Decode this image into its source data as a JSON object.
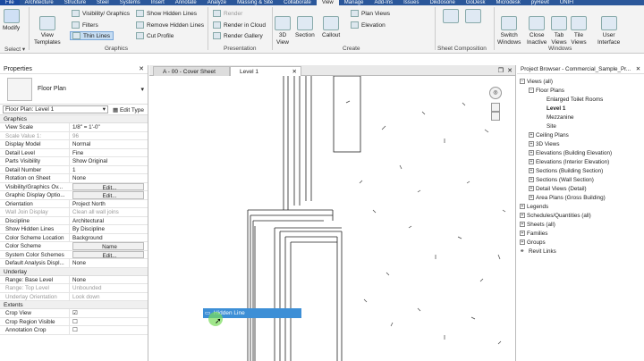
{
  "menu": [
    "File",
    "Architecture",
    "Structure",
    "Steel",
    "Systems",
    "Insert",
    "Annotate",
    "Analyze",
    "Massing & Site",
    "Collaborate",
    "View",
    "Manage",
    "Add-Ins",
    "Issues",
    "Dikdosone",
    "GoDesk",
    "Microdesk",
    "pyRevit",
    "UNIFI"
  ],
  "ribbon": {
    "modify": "Modify",
    "select": "Select ▾",
    "view_templates": "View\nTemplates",
    "visibility": "Visibility/ Graphics",
    "filters": "Filters",
    "thin_lines": "Thin  Lines",
    "show_hidden": "Show  Hidden Lines",
    "remove_hidden": "Remove  Hidden Lines",
    "cut_profile": "Cut  Profile",
    "graphics_label": "Graphics",
    "render": "Render",
    "render_cloud": "Render  in Cloud",
    "render_gallery": "Render  Gallery",
    "presentation_label": "Presentation",
    "view_3d": "3D\nView",
    "section": "Section",
    "callout": "Callout",
    "plan_views": "Plan  Views",
    "elevation": "Elevation",
    "create_label": "Create",
    "sheet_comp_label": "Sheet Composition",
    "switch_windows": "Switch\nWindows",
    "close_inactive": "Close\nInactive",
    "tab_views": "Tab\nViews",
    "tile_views": "Tile\nViews",
    "user_interface": "User\nInterface",
    "windows_label": "Windows"
  },
  "properties": {
    "title": "Properties",
    "type_name": "Floor Plan",
    "selector": "Floor Plan: Level 1",
    "edit_type": "Edit Type",
    "groups": [
      {
        "name": "Graphics",
        "rows": [
          {
            "k": "View Scale",
            "v": "1/8\" = 1'-0\""
          },
          {
            "k": "Scale Value    1:",
            "v": "96",
            "grey": true
          },
          {
            "k": "Display Model",
            "v": "Normal"
          },
          {
            "k": "Detail Level",
            "v": "Fine"
          },
          {
            "k": "Parts Visibility",
            "v": "Show Original"
          },
          {
            "k": "Detail Number",
            "v": "1"
          },
          {
            "k": "Rotation on Sheet",
            "v": "None"
          },
          {
            "k": "Visibility/Graphics Ov...",
            "v": "Edit...",
            "btn": true
          },
          {
            "k": "Graphic Display Optio...",
            "v": "Edit...",
            "btn": true
          },
          {
            "k": "Orientation",
            "v": "Project North"
          },
          {
            "k": "Wall Join Display",
            "v": "Clean all wall joins",
            "grey": true
          },
          {
            "k": "Discipline",
            "v": "Architectural"
          },
          {
            "k": "Show Hidden Lines",
            "v": "By Discipline"
          },
          {
            "k": "Color Scheme Location",
            "v": "Background"
          },
          {
            "k": "Color Scheme",
            "v": "Name",
            "btn": true
          },
          {
            "k": "System Color Schemes",
            "v": "Edit...",
            "btn": true
          },
          {
            "k": "Default Analysis Displ...",
            "v": "None"
          }
        ]
      },
      {
        "name": "Underlay",
        "rows": [
          {
            "k": "Range: Base Level",
            "v": "None"
          },
          {
            "k": "Range: Top Level",
            "v": "Unbounded",
            "grey": true
          },
          {
            "k": "Underlay Orientation",
            "v": "Look down",
            "grey": true
          }
        ]
      },
      {
        "name": "Extents",
        "rows": [
          {
            "k": "Crop View",
            "v": "☑"
          },
          {
            "k": "Crop Region Visible",
            "v": "☐"
          },
          {
            "k": "Annotation Crop",
            "v": "☐"
          }
        ]
      }
    ]
  },
  "tabs": [
    {
      "label": "A - 00 - Cover Sheet"
    },
    {
      "label": "Level 1"
    }
  ],
  "tooltip": "Hidden Line",
  "browser": {
    "title": "Project Browser - Commercial_Sample_Pr...",
    "items": [
      {
        "label": "Views (all)",
        "indent": 0,
        "tog": "−"
      },
      {
        "label": "Floor Plans",
        "indent": 1,
        "tog": "−"
      },
      {
        "label": "Enlarged Toilet Rooms",
        "indent": 2
      },
      {
        "label": "Level 1",
        "indent": 2,
        "bold": true
      },
      {
        "label": "Mezzanine",
        "indent": 2
      },
      {
        "label": "Site",
        "indent": 2
      },
      {
        "label": "Ceiling Plans",
        "indent": 1,
        "tog": "+"
      },
      {
        "label": "3D Views",
        "indent": 1,
        "tog": "+"
      },
      {
        "label": "Elevations (Building Elevation)",
        "indent": 1,
        "tog": "+"
      },
      {
        "label": "Elevations (Interior Elevation)",
        "indent": 1,
        "tog": "+"
      },
      {
        "label": "Sections (Building Section)",
        "indent": 1,
        "tog": "+"
      },
      {
        "label": "Sections (Wall Section)",
        "indent": 1,
        "tog": "+"
      },
      {
        "label": "Detail Views (Detail)",
        "indent": 1,
        "tog": "+"
      },
      {
        "label": "Area Plans (Gross Building)",
        "indent": 1,
        "tog": "+"
      },
      {
        "label": "Legends",
        "indent": 0,
        "tog": "+"
      },
      {
        "label": "Schedules/Quantities (all)",
        "indent": 0,
        "tog": "+"
      },
      {
        "label": "Sheets (all)",
        "indent": 0,
        "tog": "+"
      },
      {
        "label": "Families",
        "indent": 0,
        "tog": "+"
      },
      {
        "label": "Groups",
        "indent": 0,
        "tog": "+"
      },
      {
        "label": "Revit Links",
        "indent": 0
      }
    ]
  }
}
